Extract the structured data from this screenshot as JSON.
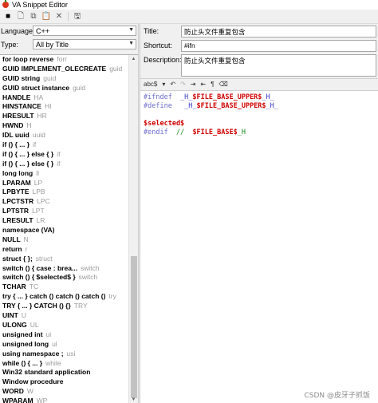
{
  "window": {
    "title": "VA Snippet Editor"
  },
  "left": {
    "language_label": "Language:",
    "language_value": "C++",
    "type_label": "Type:",
    "type_value": "All by Title",
    "snippets": [
      {
        "title": "for loop reverse",
        "shortcut": "forr"
      },
      {
        "title": "GUID IMPLEMENT_OLECREATE",
        "shortcut": "guid"
      },
      {
        "title": "GUID string",
        "shortcut": "guid"
      },
      {
        "title": "GUID struct instance",
        "shortcut": "guid"
      },
      {
        "title": "HANDLE",
        "shortcut": "HA"
      },
      {
        "title": "HINSTANCE",
        "shortcut": "HI"
      },
      {
        "title": "HRESULT",
        "shortcut": "HR"
      },
      {
        "title": "HWND",
        "shortcut": "H"
      },
      {
        "title": "IDL uuid",
        "shortcut": "uuid"
      },
      {
        "title": "if () { ... }",
        "shortcut": "if"
      },
      {
        "title": "if () { ... } else { }",
        "shortcut": "if"
      },
      {
        "title": "if () { ... } else { }",
        "shortcut": "if"
      },
      {
        "title": "long long",
        "shortcut": "ll"
      },
      {
        "title": "LPARAM",
        "shortcut": "LP"
      },
      {
        "title": "LPBYTE",
        "shortcut": "LPB"
      },
      {
        "title": "LPCTSTR",
        "shortcut": "LPC"
      },
      {
        "title": "LPTSTR",
        "shortcut": "LPT"
      },
      {
        "title": "LRESULT",
        "shortcut": "LR"
      },
      {
        "title": "namespace (VA)",
        "shortcut": ""
      },
      {
        "title": "NULL",
        "shortcut": "N"
      },
      {
        "title": "return",
        "shortcut": "r"
      },
      {
        "title": "struct { };",
        "shortcut": "struct"
      },
      {
        "title": "switch () { case : brea...",
        "shortcut": "switch"
      },
      {
        "title": "switch () { $selected$ }",
        "shortcut": "switch"
      },
      {
        "title": "TCHAR",
        "shortcut": "TC"
      },
      {
        "title": "try { ... } catch () catch () catch ()",
        "shortcut": "try"
      },
      {
        "title": "TRY { ... } CATCH () {}",
        "shortcut": "TRY"
      },
      {
        "title": "UINT",
        "shortcut": "U"
      },
      {
        "title": "ULONG",
        "shortcut": "UL"
      },
      {
        "title": "unsigned int",
        "shortcut": "ui"
      },
      {
        "title": "unsigned long",
        "shortcut": "ul"
      },
      {
        "title": "using namespace ;",
        "shortcut": "usi"
      },
      {
        "title": "while () { ... }",
        "shortcut": "while"
      },
      {
        "title": "Win32 standard application",
        "shortcut": ""
      },
      {
        "title": "Window procedure",
        "shortcut": ""
      },
      {
        "title": "WORD",
        "shortcut": "W"
      },
      {
        "title": "WPARAM",
        "shortcut": "WP"
      },
      {
        "title": "防止头文件重复包含",
        "shortcut": "#ifn",
        "selected": true
      }
    ]
  },
  "right": {
    "title_label": "Title:",
    "title_value": "防止头文件重复包含",
    "shortcut_label": "Shortcut:",
    "shortcut_value": "#ifn",
    "description_label": "Description:",
    "description_value": "防止头文件重复包含",
    "editor_toolbar": {
      "font_button": "abc$"
    },
    "code": {
      "l1_kw": "#ifndef",
      "l1_pre": "  _H_",
      "l1_red": "$FILE_BASE_UPPER$",
      "l1_post": "_H_",
      "l2_kw": "#define",
      "l2_pre": "   _H_",
      "l2_red": "$FILE_BASE_UPPER$",
      "l2_post": "_H_",
      "l3_red": "$selected$",
      "l4_kw": "#endif",
      "l4_cm_pre": "  //  ",
      "l4_red": "$FILE_BASE$",
      "l4_cm_post": "_H"
    }
  },
  "watermark": "CSDN @皮牙子抓饭",
  "colors": {
    "selected_row": "#dcdcdc",
    "keyword": "#6b6bcc",
    "variable": "#d00000"
  }
}
